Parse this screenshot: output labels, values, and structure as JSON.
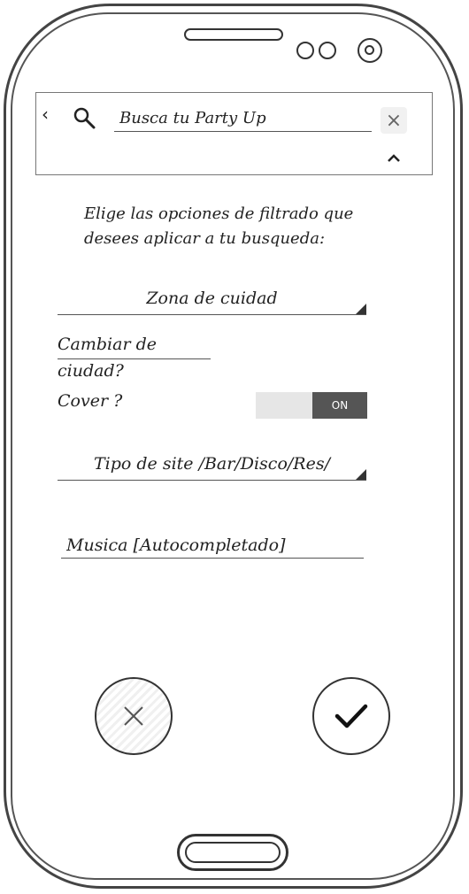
{
  "search": {
    "back_icon": "chevron-left-icon",
    "search_icon": "magnifier-icon",
    "value": "Busca tu Party Up",
    "clear_glyph": "×",
    "collapse_icon": "chevron-up-icon"
  },
  "instructions": "Elige las opciones de filtrado que desees aplicar a tu busqueda:",
  "zone_dropdown": {
    "label": "Zona de cuidad"
  },
  "change_city_link": "Cambiar de ciudad?",
  "cover": {
    "label": "Cover ?",
    "toggle_state": "ON"
  },
  "site_type_dropdown": {
    "label": "Tipo de site /Bar/Disco/Res/"
  },
  "music_input": {
    "value": "Musica [Autocompletado]"
  },
  "actions": {
    "cancel_icon": "close-icon",
    "confirm_icon": "check-icon"
  }
}
